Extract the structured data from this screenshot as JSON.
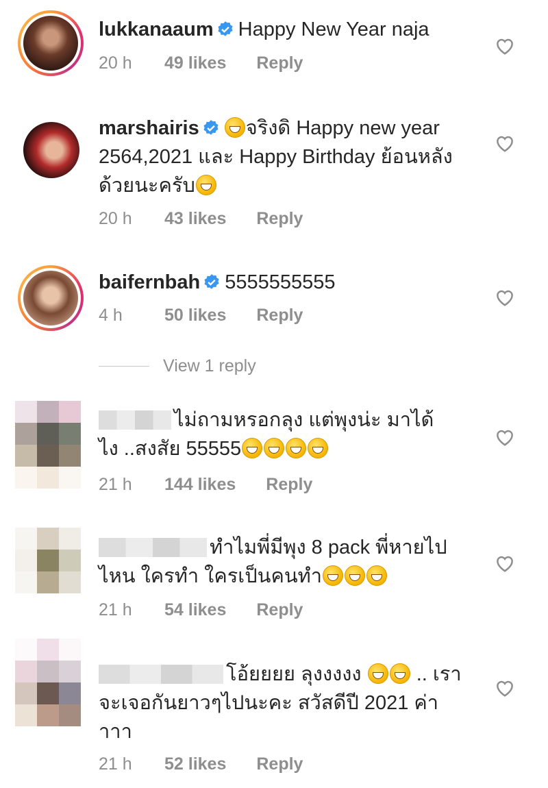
{
  "comments": [
    {
      "username": "lukkanaaum",
      "verified": true,
      "text": "Happy New Year naja",
      "time": "20 h",
      "likes": "49 likes",
      "reply": "Reply"
    },
    {
      "username": "marshairis",
      "verified": true,
      "text_line1": "จริงดิ Happy new year",
      "text_line2": "2564,2021 และ Happy Birthday ย้อนหลัง",
      "text_line3": "ด้วยนะครับ",
      "time": "20 h",
      "likes": "43 likes",
      "reply": "Reply"
    },
    {
      "username": "baifernbah",
      "verified": true,
      "text": "5555555555",
      "time": "4 h",
      "likes": "50 likes",
      "reply": "Reply"
    },
    {
      "text_line1": "ไม่ถามหรอกลุง แต่พุงน่ะ มาได้",
      "text_line2": "ไง ..สงสัย 55555",
      "time": "21 h",
      "likes": "144 likes",
      "reply": "Reply"
    },
    {
      "text_line1": "ทำไมพี่มีพุง 8 pack พี่หายไป",
      "text_line2": "ไหน ใครทำ ใครเป็นคนทำ",
      "time": "21 h",
      "likes": "54 likes",
      "reply": "Reply"
    },
    {
      "text_line1": "โอ้ยยยย ลุงงงงง",
      "text_line1b": ".. เรา",
      "text_line2": "จะเจอกันยาวๆไปนะคะ สวัสดีปี 2021 ค่า",
      "text_line3": "าาา",
      "time": "21 h",
      "likes": "52 likes",
      "reply": "Reply"
    }
  ],
  "view_replies": "View 1 reply",
  "colors": {
    "verified": "#3897f0",
    "meta": "#8e8e8e",
    "text": "#262626"
  },
  "icons": [
    "verified-badge-icon",
    "heart-icon",
    "emoji-icon"
  ]
}
